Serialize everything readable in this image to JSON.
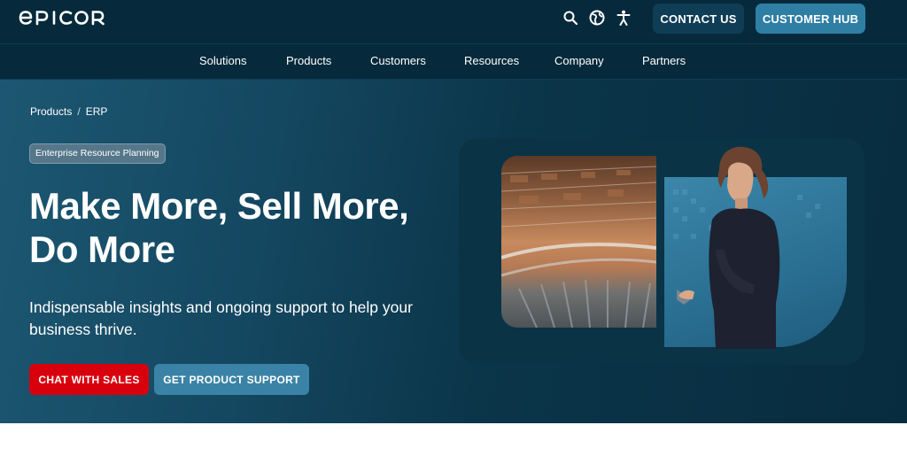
{
  "brand": {
    "logo_text": "EPICOR"
  },
  "header": {
    "icons": [
      "search-icon",
      "globe-icon",
      "accessibility-icon"
    ],
    "contact_label": "CONTACT US",
    "hub_label": "CUSTOMER HUB"
  },
  "nav": {
    "items": [
      {
        "label": "Solutions"
      },
      {
        "label": "Products"
      },
      {
        "label": "Customers"
      },
      {
        "label": "Resources"
      },
      {
        "label": "Company"
      },
      {
        "label": "Partners"
      }
    ]
  },
  "hero": {
    "breadcrumb": [
      "Products",
      "ERP"
    ],
    "breadcrumb_sep": "/",
    "tag": "Enterprise Resource Planning",
    "headline_line1": "Make More, Sell More,",
    "headline_line2": "Do More",
    "subhead": "Indispensable insights and ongoing support to help your business thrive.",
    "cta_primary": "CHAT WITH SALES",
    "cta_secondary": "GET PRODUCT SUPPORT"
  },
  "colors": {
    "header_bg": "#062a3b",
    "hero_bg": "#0b3549",
    "primary_cta": "#d9000d",
    "secondary_cta": "#3a83a6",
    "hub_button": "#2f7fa4"
  }
}
